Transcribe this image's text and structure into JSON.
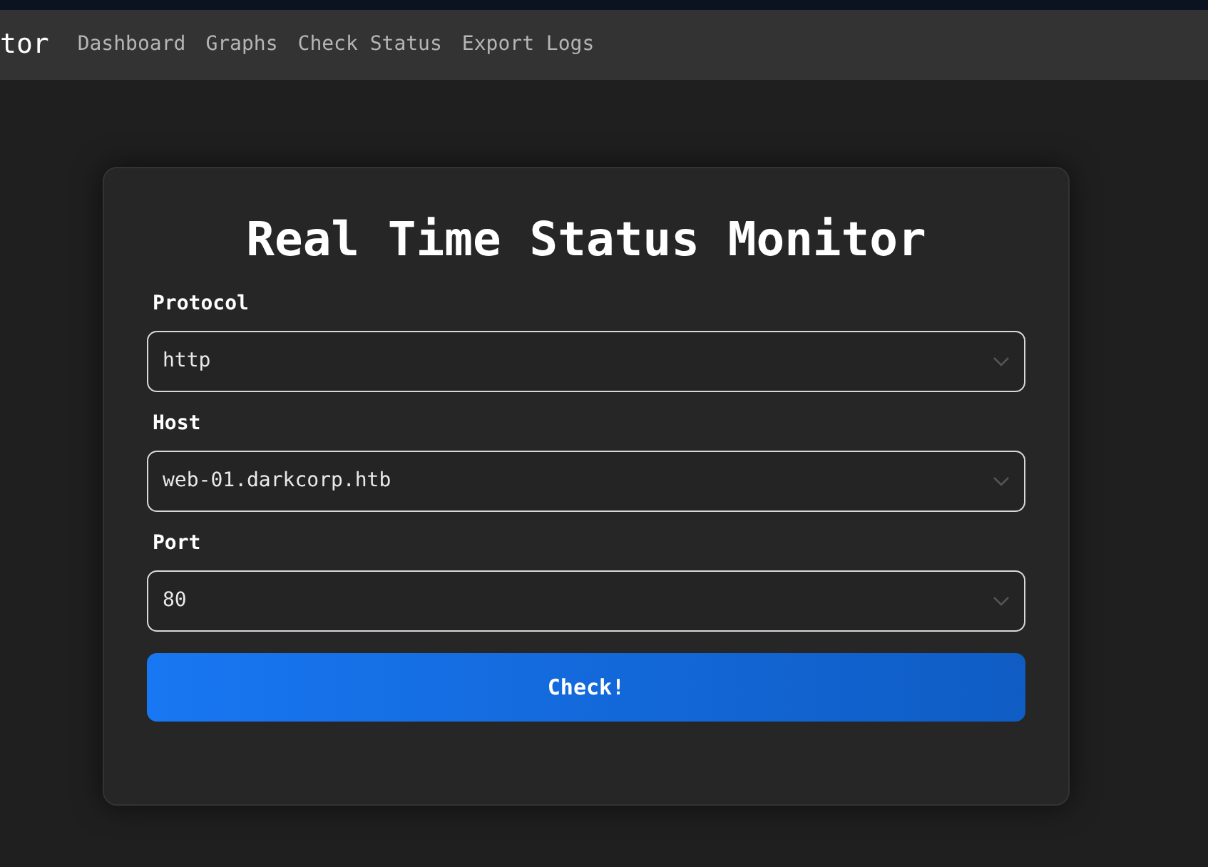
{
  "nav": {
    "brand": "tor",
    "links": [
      "Dashboard",
      "Graphs",
      "Check Status",
      "Export Logs"
    ]
  },
  "form": {
    "title": "Real Time Status Monitor",
    "fields": [
      {
        "label": "Protocol",
        "value": "http"
      },
      {
        "label": "Host",
        "value": "web-01.darkcorp.htb"
      },
      {
        "label": "Port",
        "value": "80"
      }
    ],
    "button": "Check!"
  }
}
